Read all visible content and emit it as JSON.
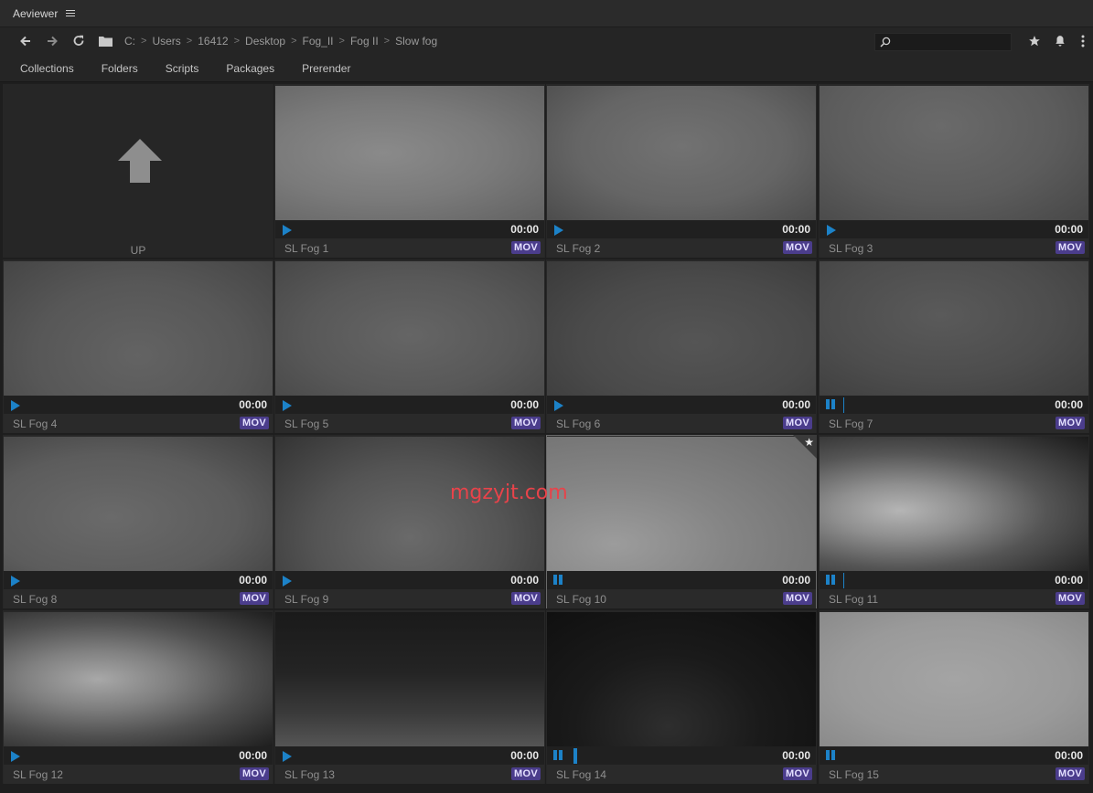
{
  "app": {
    "title": "Aeviewer",
    "menu_icon": "hamburger-menu-icon"
  },
  "toolbar": {
    "back_icon": "arrow-left-icon",
    "forward_icon": "arrow-right-icon",
    "refresh_icon": "refresh-icon",
    "folder_icon": "folder-icon",
    "breadcrumb": [
      "C:",
      "Users",
      "16412",
      "Desktop",
      "Fog_II",
      "Fog II",
      "Slow fog"
    ],
    "search_placeholder": "",
    "right_icons": [
      "star-icon",
      "bell-icon",
      "more-vertical-icon"
    ]
  },
  "tabs": [
    "Collections",
    "Folders",
    "Scripts",
    "Packages",
    "Prerender"
  ],
  "colors": {
    "accent_blue": "#1c82c8",
    "badge_purple": "#4b3d8c",
    "watermark_red": "#e8434a"
  },
  "up": {
    "label": "UP",
    "icon": "arrow-up-icon"
  },
  "items": [
    {
      "name": "SL Fog 1",
      "time": "00:00",
      "badge": "MOV",
      "state": "play"
    },
    {
      "name": "SL Fog 2",
      "time": "00:00",
      "badge": "MOV",
      "state": "play"
    },
    {
      "name": "SL Fog 3",
      "time": "00:00",
      "badge": "MOV",
      "state": "play"
    },
    {
      "name": "SL Fog 4",
      "time": "00:00",
      "badge": "MOV",
      "state": "play"
    },
    {
      "name": "SL Fog 5",
      "time": "00:00",
      "badge": "MOV",
      "state": "play"
    },
    {
      "name": "SL Fog 6",
      "time": "00:00",
      "badge": "MOV",
      "state": "play"
    },
    {
      "name": "SL Fog 7",
      "time": "00:00",
      "badge": "MOV",
      "state": "pause"
    },
    {
      "name": "SL Fog 8",
      "time": "00:00",
      "badge": "MOV",
      "state": "play"
    },
    {
      "name": "SL Fog 9",
      "time": "00:00",
      "badge": "MOV",
      "state": "play"
    },
    {
      "name": "SL Fog 10",
      "time": "00:00",
      "badge": "MOV",
      "state": "pause",
      "selected": true,
      "favorite": true
    },
    {
      "name": "SL Fog 11",
      "time": "00:00",
      "badge": "MOV",
      "state": "pause"
    },
    {
      "name": "SL Fog 12",
      "time": "00:00",
      "badge": "MOV",
      "state": "play"
    },
    {
      "name": "SL Fog 13",
      "time": "00:00",
      "badge": "MOV",
      "state": "play"
    },
    {
      "name": "SL Fog 14",
      "time": "00:00",
      "badge": "MOV",
      "state": "pause"
    },
    {
      "name": "SL Fog 15",
      "time": "00:00",
      "badge": "MOV",
      "state": "pause"
    }
  ],
  "watermark": "mgzyjt.com"
}
